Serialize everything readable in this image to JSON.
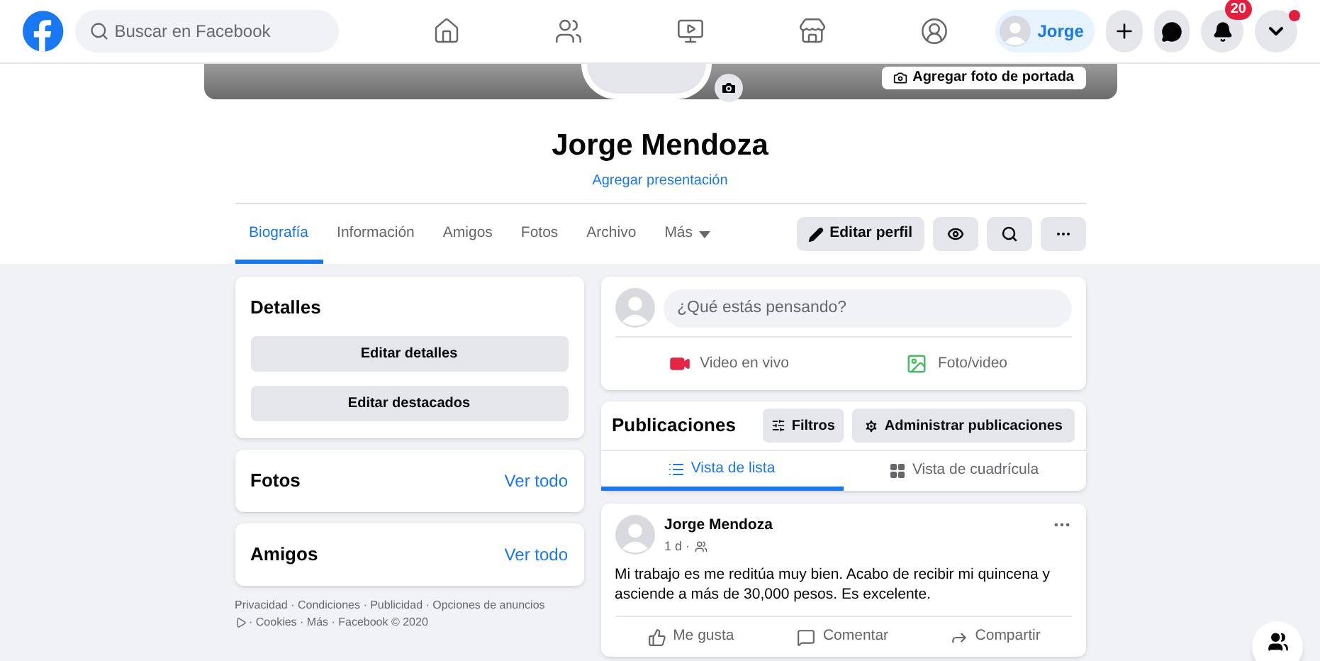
{
  "nav": {
    "search": {
      "placeholder": "Buscar en Facebook"
    },
    "tabs": [
      {
        "kind": "home",
        "selected": false
      },
      {
        "kind": "friends",
        "selected": false
      },
      {
        "kind": "watch",
        "selected": false
      },
      {
        "kind": "marketplace",
        "selected": false
      },
      {
        "kind": "groups",
        "selected": false
      }
    ],
    "profile_chip": "Jorge",
    "notifications_badge": "20",
    "menu_alert": true
  },
  "cover": {
    "button": "Agregar foto de portada"
  },
  "profile": {
    "name": "Jorge Mendoza",
    "subtitle": "Agregar presentación",
    "tabs": [
      {
        "label": "Biografía",
        "selected": true
      },
      {
        "label": "Información",
        "selected": false
      },
      {
        "label": "Amigos",
        "selected": false
      },
      {
        "label": "Fotos",
        "selected": false
      },
      {
        "label": "Archivo",
        "selected": false
      },
      {
        "label": "Más",
        "selected": false
      }
    ],
    "edit_button": "Editar perfil"
  },
  "details": {
    "title": "Detalles",
    "buttons": [
      "Editar detalles",
      "Editar destacados"
    ]
  },
  "photos": {
    "title": "Fotos",
    "link": "Ver todo"
  },
  "friends": {
    "title": "Amigos",
    "link": "Ver todo"
  },
  "footer": {
    "line1": "Privacidad · Condiciones · Publicidad · Opciones de anuncios",
    "line2": "· Cookies · Más · Facebook © 2020"
  },
  "composer": {
    "placeholder": "¿Qué estás pensando?",
    "actions": [
      {
        "kind": "live",
        "label": "Video en vivo"
      },
      {
        "label": "Foto/video"
      }
    ]
  },
  "posts_header": {
    "title": "Publicaciones",
    "filters": "Filtros",
    "manage": "Administrar publicaciones",
    "views": [
      {
        "kind": "list",
        "label": "Vista de lista",
        "selected": true
      },
      {
        "kind": "grid",
        "label": "Vista de cuadrícula",
        "selected": false
      }
    ]
  },
  "post": {
    "author": "Jorge Mendoza",
    "time": "1 d ·",
    "text": "Mi trabajo es me reditúa muy bien. Acabo de recibir mi quincena y asciende a más de 30,000 pesos. Es excelente.",
    "actions": [
      {
        "kind": "like",
        "label": "Me gusta"
      },
      {
        "kind": "comment",
        "label": "Comentar"
      },
      {
        "kind": "share",
        "label": "Compartir"
      }
    ]
  }
}
